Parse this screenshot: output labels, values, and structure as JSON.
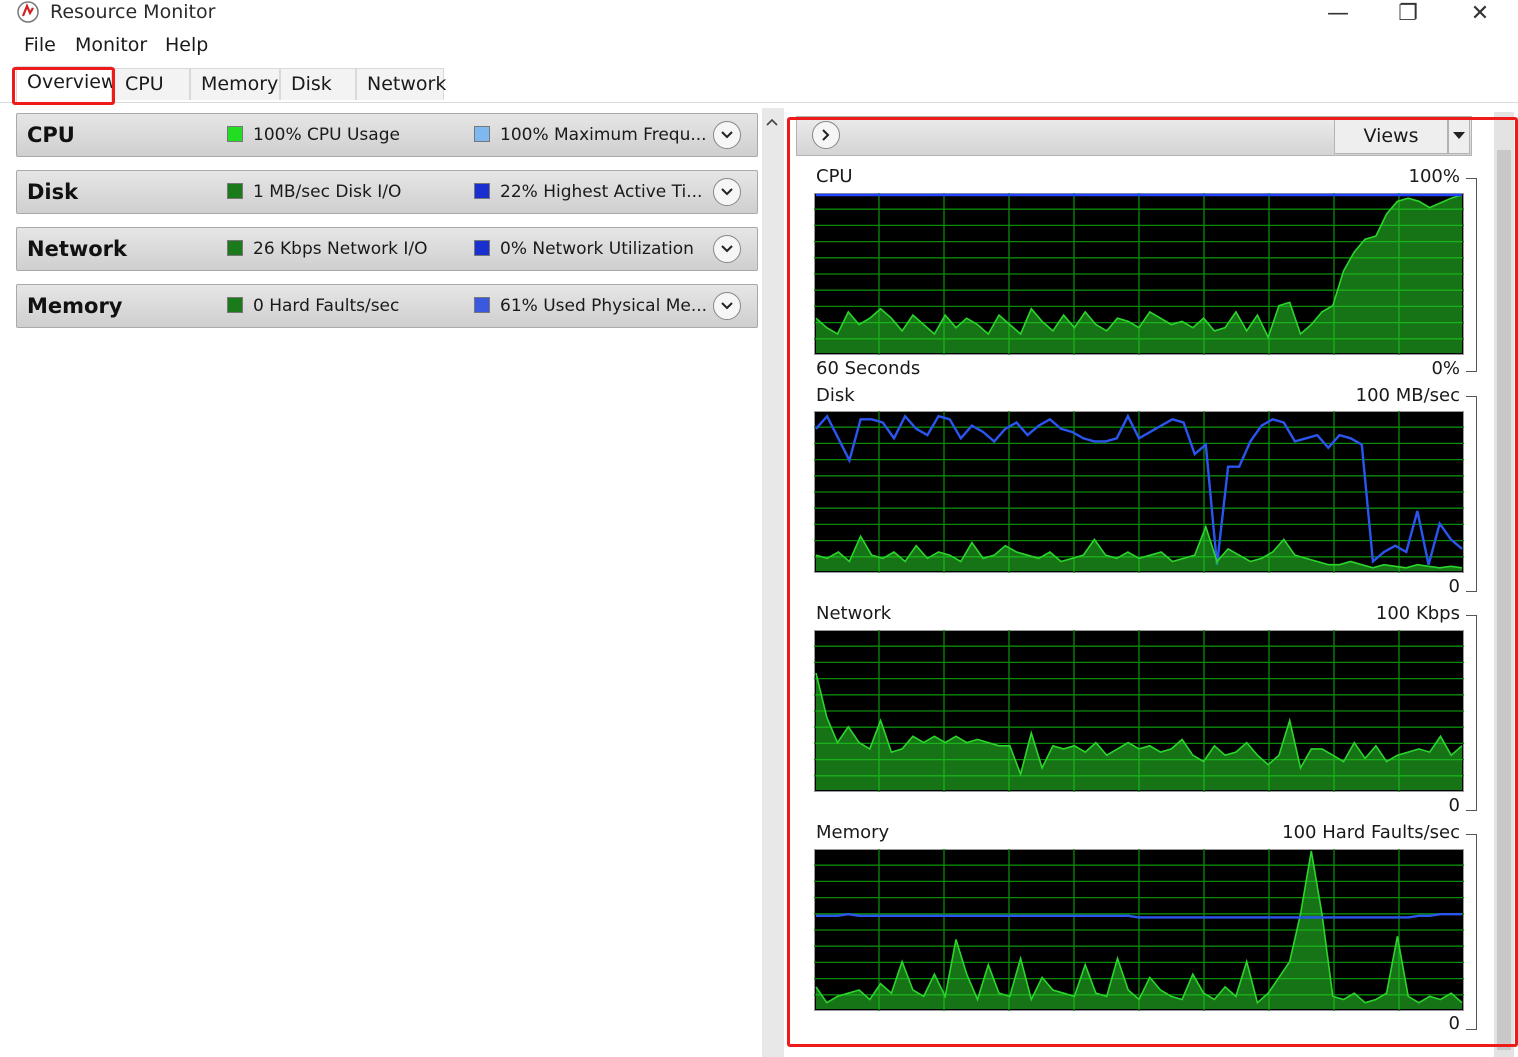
{
  "window": {
    "title": "Resource Monitor",
    "controls": {
      "minimize": "—",
      "maximize": "❐",
      "close": "✕"
    }
  },
  "menu": {
    "items": [
      "File",
      "Monitor",
      "Help"
    ]
  },
  "tabs": [
    {
      "label": "Overview",
      "active": true
    },
    {
      "label": "CPU",
      "active": false
    },
    {
      "label": "Memory",
      "active": false
    },
    {
      "label": "Disk",
      "active": false
    },
    {
      "label": "Network",
      "active": false
    }
  ],
  "sections": [
    {
      "title": "CPU",
      "stat1": "100% CPU Usage",
      "stat1_color": "#22dd22",
      "stat2": "100% Maximum Frequ...",
      "stat2_color": "#7fb8f0"
    },
    {
      "title": "Disk",
      "stat1": "1 MB/sec Disk I/O",
      "stat1_color": "#1b7a1b",
      "stat2": "22% Highest Active Ti...",
      "stat2_color": "#1a2fd0"
    },
    {
      "title": "Network",
      "stat1": "26 Kbps Network I/O",
      "stat1_color": "#1b7a1b",
      "stat2": "0% Network Utilization",
      "stat2_color": "#1a2fd0"
    },
    {
      "title": "Memory",
      "stat1": "0 Hard Faults/sec",
      "stat1_color": "#1b7a1b",
      "stat2": "61% Used Physical Me...",
      "stat2_color": "#3a58e0"
    }
  ],
  "right_panel": {
    "views_label": "Views",
    "graphs": [
      {
        "name": "CPU",
        "max_label": "100%",
        "bottom_left": "60 Seconds",
        "bottom_right": "0%"
      },
      {
        "name": "Disk",
        "max_label": "100 MB/sec",
        "bottom_left": "",
        "bottom_right": "0"
      },
      {
        "name": "Network",
        "max_label": "100 Kbps",
        "bottom_left": "",
        "bottom_right": "0"
      },
      {
        "name": "Memory",
        "max_label": "100 Hard Faults/sec",
        "bottom_left": "",
        "bottom_right": "0"
      }
    ]
  },
  "chart_data": [
    {
      "type": "area",
      "title": "CPU",
      "ylim": [
        0,
        100
      ],
      "xlabel": "60 Seconds",
      "series": [
        {
          "name": "",
          "color": "#22cc22",
          "values": [
            22,
            16,
            12,
            26,
            18,
            22,
            28,
            22,
            14,
            24,
            18,
            12,
            24,
            16,
            22,
            18,
            12,
            24,
            18,
            12,
            28,
            20,
            14,
            24,
            16,
            26,
            18,
            14,
            22,
            20,
            16,
            26,
            22,
            18,
            20,
            16,
            22,
            14,
            16,
            26,
            14,
            24,
            10,
            30,
            32,
            12,
            18,
            26,
            30,
            52,
            64,
            72,
            74,
            88,
            96,
            98,
            96,
            92,
            95,
            98,
            100
          ]
        },
        {
          "name": "",
          "color": "#2244ff",
          "values": [
            100,
            100,
            100,
            100,
            100,
            100,
            100,
            100,
            100,
            100,
            100,
            100,
            100,
            100,
            100,
            100,
            100,
            100,
            100,
            100,
            100,
            100,
            100,
            100,
            100,
            100,
            100,
            100,
            100,
            100,
            100,
            100,
            100,
            100,
            100,
            100,
            100,
            100,
            100,
            100,
            100,
            100,
            100,
            100,
            100,
            100,
            100,
            100,
            100,
            100,
            100,
            100,
            100,
            100,
            100,
            100,
            100,
            100,
            100,
            100,
            100
          ]
        }
      ]
    },
    {
      "type": "line",
      "title": "Disk",
      "ylim": [
        0,
        100
      ],
      "series": [
        {
          "name": "",
          "color": "#2a55ee",
          "values": [
            90,
            98,
            84,
            70,
            96,
            96,
            94,
            84,
            98,
            90,
            86,
            98,
            96,
            84,
            92,
            88,
            82,
            90,
            94,
            86,
            92,
            96,
            90,
            88,
            84,
            82,
            82,
            84,
            98,
            84,
            88,
            92,
            96,
            94,
            74,
            80,
            4,
            66,
            66,
            82,
            92,
            96,
            94,
            82,
            84,
            86,
            78,
            86,
            84,
            80,
            6,
            12,
            16,
            12,
            38,
            4,
            30,
            20,
            14
          ]
        },
        {
          "name": "",
          "color": "#22cc22",
          "values": [
            10,
            8,
            12,
            6,
            22,
            10,
            8,
            12,
            6,
            16,
            8,
            12,
            10,
            6,
            18,
            8,
            10,
            16,
            12,
            10,
            8,
            12,
            6,
            8,
            10,
            20,
            10,
            8,
            12,
            8,
            10,
            12,
            6,
            8,
            10,
            28,
            6,
            14,
            10,
            6,
            8,
            12,
            20,
            10,
            8,
            6,
            4,
            4,
            6,
            4,
            2,
            4,
            3,
            2,
            4,
            3,
            2,
            3,
            2
          ]
        }
      ]
    },
    {
      "type": "area",
      "title": "Network",
      "ylim": [
        0,
        100
      ],
      "series": [
        {
          "name": "",
          "color": "#22cc22",
          "values": [
            74,
            46,
            30,
            40,
            30,
            26,
            44,
            24,
            26,
            34,
            30,
            34,
            30,
            34,
            30,
            32,
            30,
            28,
            28,
            10,
            36,
            14,
            28,
            26,
            28,
            24,
            30,
            22,
            26,
            30,
            26,
            28,
            24,
            26,
            32,
            22,
            18,
            28,
            22,
            24,
            30,
            22,
            16,
            22,
            44,
            14,
            26,
            26,
            22,
            18,
            30,
            20,
            28,
            18,
            22,
            24,
            26,
            24,
            34,
            22,
            28
          ]
        }
      ]
    },
    {
      "type": "area",
      "title": "Memory",
      "ylim": [
        0,
        100
      ],
      "series": [
        {
          "name": "",
          "color": "#22cc22",
          "values": [
            14,
            4,
            8,
            10,
            12,
            6,
            16,
            10,
            30,
            12,
            8,
            22,
            8,
            44,
            22,
            6,
            28,
            10,
            8,
            32,
            6,
            20,
            12,
            10,
            8,
            28,
            10,
            8,
            32,
            12,
            6,
            20,
            12,
            8,
            6,
            22,
            10,
            6,
            14,
            8,
            30,
            4,
            10,
            20,
            30,
            60,
            100,
            60,
            8,
            6,
            10,
            4,
            6,
            10,
            46,
            8,
            4,
            8,
            6,
            10,
            4
          ]
        },
        {
          "name": "",
          "color": "#2a55ee",
          "values": [
            59,
            59,
            59,
            60,
            59,
            59,
            59,
            59,
            59,
            59,
            59,
            59,
            59,
            59,
            59,
            59,
            59,
            59,
            59,
            59,
            59,
            59,
            59,
            59,
            59,
            59,
            59,
            59,
            59,
            59,
            58,
            58,
            58,
            58,
            58,
            58,
            58,
            58,
            58,
            58,
            58,
            58,
            58,
            58,
            58,
            58,
            58,
            58,
            58,
            58,
            58,
            58,
            58,
            58,
            58,
            58,
            59,
            59,
            60,
            60,
            60
          ]
        }
      ]
    }
  ]
}
